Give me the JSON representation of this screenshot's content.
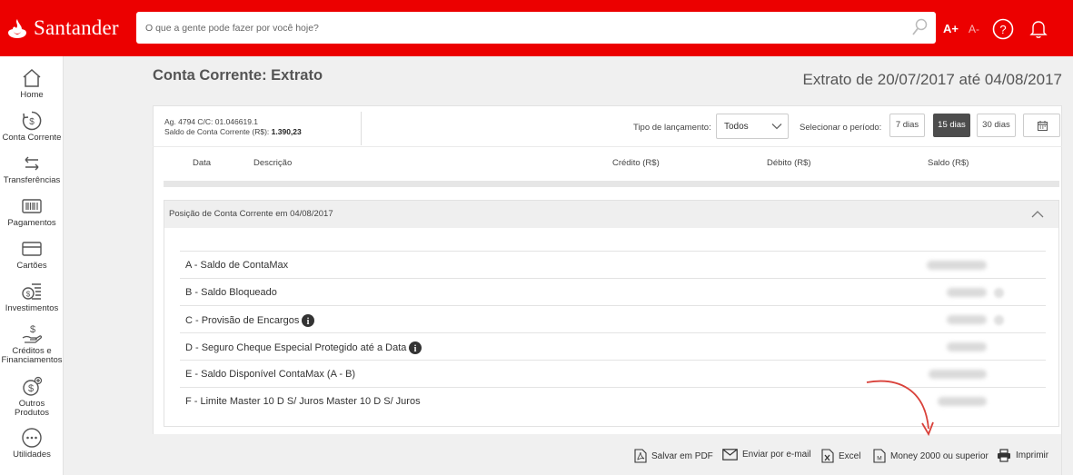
{
  "brand": {
    "name": "Santander",
    "color": "#ec0000"
  },
  "header": {
    "search_placeholder": "O que a gente pode fazer por você hoje?",
    "font_increase": "A+",
    "font_decrease": "A-"
  },
  "sidebar": {
    "items": [
      {
        "label": "Home",
        "icon": "home-icon"
      },
      {
        "label": "Conta Corrente",
        "icon": "cash-cycle-icon"
      },
      {
        "label": "Transferências",
        "icon": "transfer-arrows-icon"
      },
      {
        "label": "Pagamentos",
        "icon": "barcode-icon"
      },
      {
        "label": "Cartões",
        "icon": "card-icon"
      },
      {
        "label": "Investimentos",
        "icon": "investment-icon"
      },
      {
        "label_line1": "Créditos e",
        "label_line2": "Financiamentos",
        "icon": "hand-money-icon"
      },
      {
        "label_line1": "Outros",
        "label_line2": "Produtos",
        "icon": "plus-money-icon"
      },
      {
        "label": "Utilidades",
        "icon": "more-dots-icon"
      }
    ]
  },
  "page": {
    "title": "Conta Corrente: Extrato",
    "period_title": "Extrato de 20/07/2017 até 04/08/2017"
  },
  "account": {
    "line1": "Ag. 4794 C/C: 01.046619.1",
    "balance_label": "Saldo de Conta Corrente (R$):",
    "balance_value": "1.390,23"
  },
  "filters": {
    "type_label": "Tipo de lançamento:",
    "type_value": "Todos",
    "period_label": "Selecionar o período:",
    "period_options": [
      "7 dias",
      "15 dias",
      "30 dias"
    ],
    "period_selected": "15 dias"
  },
  "table": {
    "columns": [
      "Data",
      "Descrição",
      "Crédito (R$)",
      "Débito (R$)",
      "Saldo (R$)"
    ]
  },
  "position": {
    "title": "Posição de Conta Corrente em 04/08/2017",
    "rows": [
      {
        "label": "A - Saldo de ContaMax",
        "info": false
      },
      {
        "label": "B - Saldo Bloqueado",
        "info": false
      },
      {
        "label": "C - Provisão de Encargos",
        "info": true
      },
      {
        "label": "D - Seguro Cheque Especial Protegido até a Data",
        "info": true
      },
      {
        "label": "E - Saldo Disponível ContaMax (A - B)",
        "info": false
      },
      {
        "label": "F - Limite Master 10 D S/ Juros Master 10 D S/ Juros",
        "info": false
      }
    ]
  },
  "actions": {
    "pdf": "Salvar em PDF",
    "email": "Enviar por e-mail",
    "excel": "Excel",
    "money": "Money 2000 ou superior",
    "print": "Imprimir"
  },
  "annotation_color": "#d9413a"
}
